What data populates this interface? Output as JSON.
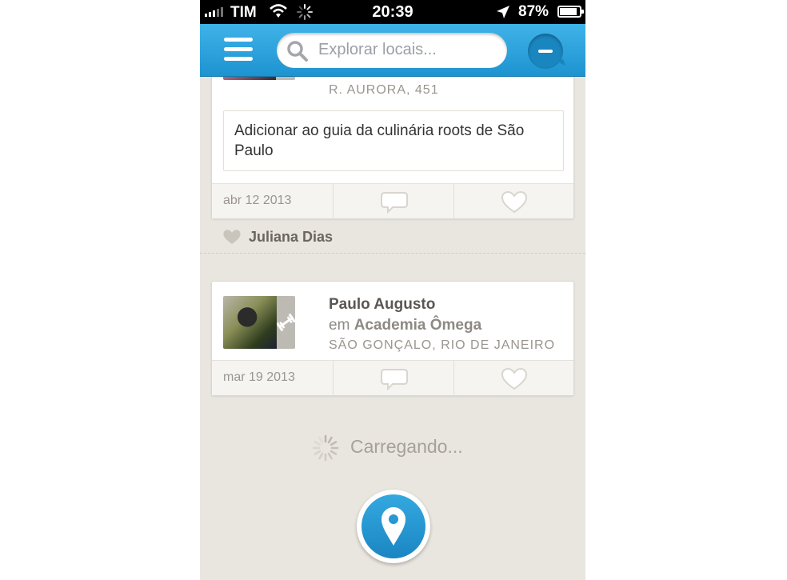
{
  "status_bar": {
    "carrier": "TIM",
    "time": "20:39",
    "battery_percent": "87%",
    "battery_level": 0.87
  },
  "navbar": {
    "search_placeholder": "Explorar locais...",
    "menu_icon": "hamburger-menu-icon",
    "chat_icon": "chat-bubble-icon"
  },
  "feed": {
    "items": [
      {
        "address": "R. AURORA, 451",
        "comment": "Adicionar ao guia da culinária roots de São Paulo",
        "date": "abr 12 2013",
        "comment_icon": "comment-icon",
        "like_icon": "heart-icon"
      },
      {
        "user": "Paulo Augusto",
        "preposition": "em",
        "venue": "Academia Ômega",
        "address": "SÃO GONÇALO, RIO DE JANEIRO",
        "category_icon": "dumbbell-icon",
        "date": "mar 19 2013",
        "comment_icon": "comment-icon",
        "like_icon": "heart-icon"
      }
    ],
    "like": {
      "name": "Juliana Dias",
      "icon": "heart-icon"
    },
    "loading_text": "Carregando..."
  },
  "checkin_button": {
    "icon": "map-pin-icon"
  },
  "colors": {
    "navbar_blue": "#2aa2dd",
    "background": "#e9e5df",
    "card": "#ffffff"
  }
}
